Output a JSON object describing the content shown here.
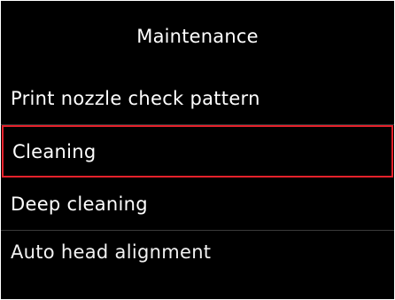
{
  "header": {
    "title": "Maintenance"
  },
  "menu": {
    "items": [
      {
        "label": "Print nozzle check pattern",
        "selected": false
      },
      {
        "label": "Cleaning",
        "selected": true
      },
      {
        "label": "Deep cleaning",
        "selected": false
      },
      {
        "label": "Auto head alignment",
        "selected": false
      }
    ]
  },
  "colors": {
    "background": "#000000",
    "text": "#ffffff",
    "selection": "#e5212b"
  }
}
